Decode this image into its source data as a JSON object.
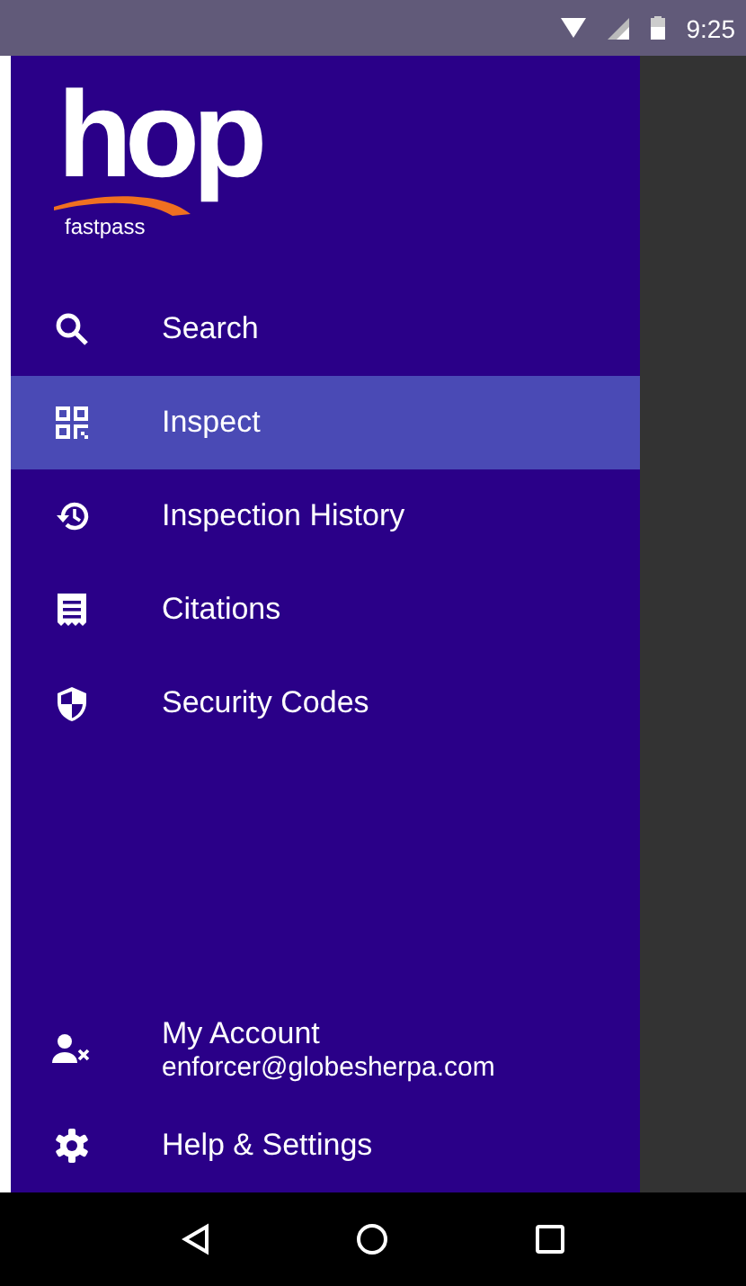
{
  "status_bar": {
    "time": "9:25"
  },
  "logo": {
    "wordmark": "hop",
    "tagline": "fastpass"
  },
  "menu": [
    {
      "label": "Search",
      "selected": false
    },
    {
      "label": "Inspect",
      "selected": true
    },
    {
      "label": "Inspection History",
      "selected": false
    },
    {
      "label": "Citations",
      "selected": false
    },
    {
      "label": "Security Codes",
      "selected": false
    }
  ],
  "account": {
    "label": "My Account",
    "email": "enforcer@globesherpa.com"
  },
  "settings": {
    "label": "Help & Settings"
  }
}
